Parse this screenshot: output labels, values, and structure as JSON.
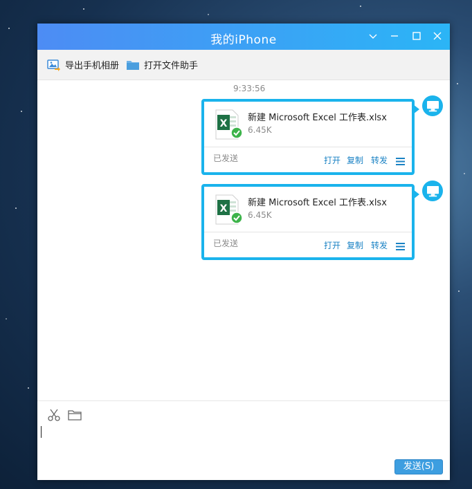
{
  "window": {
    "title": "我的iPhone"
  },
  "toolbar": {
    "export_album": "导出手机相册",
    "open_file_assistant": "打开文件助手"
  },
  "chat": {
    "timestamp": "9:33:56",
    "messages": [
      {
        "file_name": "新建 Microsoft Excel 工作表.xlsx",
        "file_size": "6.45K",
        "status": "已发送",
        "actions": {
          "open": "打开",
          "copy": "复制",
          "forward": "转发"
        }
      },
      {
        "file_name": "新建 Microsoft Excel 工作表.xlsx",
        "file_size": "6.45K",
        "status": "已发送",
        "actions": {
          "open": "打开",
          "copy": "复制",
          "forward": "转发"
        }
      }
    ]
  },
  "input": {
    "send_label": "发送(S)"
  },
  "colors": {
    "accent": "#1ab3ec",
    "title_gradient_start": "#4d8cf4",
    "title_gradient_end": "#2bb5f6",
    "excel_green": "#1e7145",
    "send_button": "#3d9ee0"
  },
  "icons": [
    "chevron-down-icon",
    "minimize-icon",
    "maximize-icon",
    "close-icon",
    "image-export-icon",
    "folder-icon",
    "excel-file-icon",
    "check-icon",
    "computer-icon",
    "menu-icon",
    "scissors-icon"
  ]
}
